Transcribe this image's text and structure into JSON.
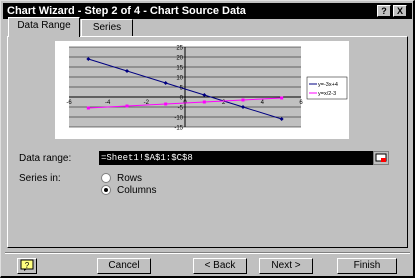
{
  "window": {
    "title": "Chart Wizard - Step 2 of 4 - Chart Source Data",
    "help_glyph": "?",
    "close_glyph": "X"
  },
  "tabs": [
    {
      "label": "Data Range",
      "active": true
    },
    {
      "label": "Series",
      "active": false
    }
  ],
  "chart_data": {
    "type": "line",
    "x_ticks": [
      "-6",
      "-4",
      "-2",
      "0",
      "2",
      "4",
      "6"
    ],
    "y_ticks": [
      "25",
      "20",
      "15",
      "10",
      "5",
      "0",
      "-5",
      "-10",
      "-15"
    ],
    "xlim": [
      -6,
      6
    ],
    "ylim": [
      -15,
      25
    ],
    "x": [
      -5,
      -3,
      -1,
      1,
      3,
      5
    ],
    "series": [
      {
        "name": "y=-3x+4",
        "values": [
          19,
          13,
          7,
          1,
          -5,
          -11
        ],
        "color": "#000080"
      },
      {
        "name": "y=x/2-3",
        "values": [
          -5.5,
          -4.5,
          -3.5,
          -2.5,
          -1.5,
          -0.5
        ],
        "color": "#ff00ff"
      }
    ],
    "grid": true,
    "legend": "right"
  },
  "form": {
    "data_range_label": "Data range:",
    "data_range_value": "=Sheet1!$A$1:$C$8",
    "series_in_label": "Series in:",
    "series_options": [
      {
        "label": "Rows",
        "selected": false
      },
      {
        "label": "Columns",
        "selected": true
      }
    ]
  },
  "buttons": {
    "cancel": "Cancel",
    "back": "< Back",
    "next": "Next >",
    "finish": "Finish"
  },
  "icons": {
    "help": "office-assistant-icon",
    "collapse": "collapse-dialog-icon"
  }
}
